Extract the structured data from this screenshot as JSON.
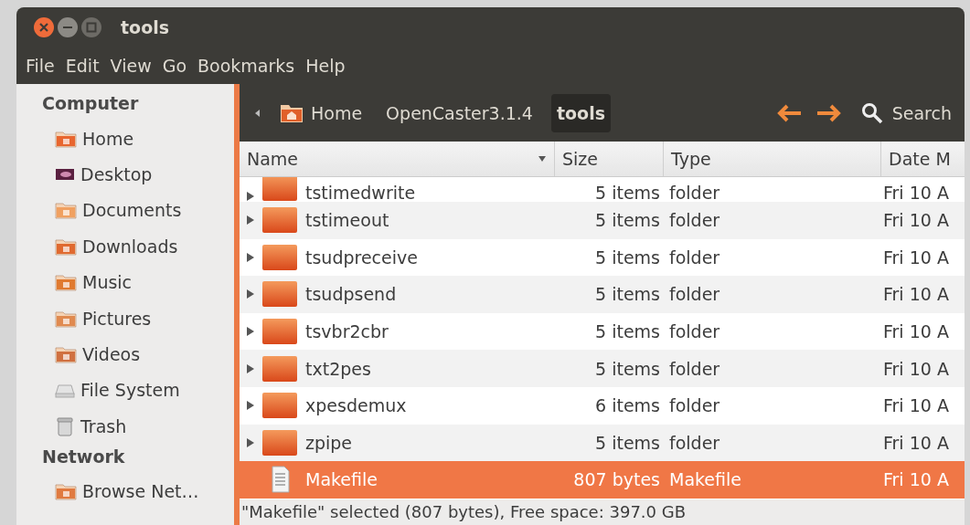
{
  "window": {
    "title": "tools"
  },
  "menu": [
    "File",
    "Edit",
    "View",
    "Go",
    "Bookmarks",
    "Help"
  ],
  "sidebar": {
    "sections": [
      {
        "heading": "Computer",
        "items": [
          {
            "kind": "home",
            "label": "Home"
          },
          {
            "kind": "desktop",
            "label": "Desktop"
          },
          {
            "kind": "documents",
            "label": "Documents"
          },
          {
            "kind": "downloads",
            "label": "Downloads"
          },
          {
            "kind": "music",
            "label": "Music"
          },
          {
            "kind": "pictures",
            "label": "Pictures"
          },
          {
            "kind": "videos",
            "label": "Videos"
          },
          {
            "kind": "drive",
            "label": "File System"
          },
          {
            "kind": "trash",
            "label": "Trash"
          }
        ]
      },
      {
        "heading": "Network",
        "items": [
          {
            "kind": "network",
            "label": "Browse Net…"
          }
        ]
      }
    ]
  },
  "toolbar": {
    "breadcrumbs": [
      {
        "label": "Home",
        "home": true,
        "selected": false
      },
      {
        "label": "OpenCaster3.1.4",
        "home": false,
        "selected": false
      },
      {
        "label": "tools",
        "home": false,
        "selected": true
      }
    ],
    "search": "Search"
  },
  "table": {
    "columns": [
      "Name",
      "Size",
      "Type",
      "Date M"
    ],
    "rows": [
      {
        "kind": "folder",
        "name": "tstimedwrite",
        "size": "5 items",
        "type": "folder",
        "date": "Fri 10 A",
        "selected": false,
        "partial": true
      },
      {
        "kind": "folder",
        "name": "tstimeout",
        "size": "5 items",
        "type": "folder",
        "date": "Fri 10 A",
        "selected": false,
        "partial": false
      },
      {
        "kind": "folder",
        "name": "tsudpreceive",
        "size": "5 items",
        "type": "folder",
        "date": "Fri 10 A",
        "selected": false,
        "partial": false
      },
      {
        "kind": "folder",
        "name": "tsudpsend",
        "size": "5 items",
        "type": "folder",
        "date": "Fri 10 A",
        "selected": false,
        "partial": false
      },
      {
        "kind": "folder",
        "name": "tsvbr2cbr",
        "size": "5 items",
        "type": "folder",
        "date": "Fri 10 A",
        "selected": false,
        "partial": false
      },
      {
        "kind": "folder",
        "name": "txt2pes",
        "size": "5 items",
        "type": "folder",
        "date": "Fri 10 A",
        "selected": false,
        "partial": false
      },
      {
        "kind": "folder",
        "name": "xpesdemux",
        "size": "6 items",
        "type": "folder",
        "date": "Fri 10 A",
        "selected": false,
        "partial": false
      },
      {
        "kind": "folder",
        "name": "zpipe",
        "size": "5 items",
        "type": "folder",
        "date": "Fri 10 A",
        "selected": false,
        "partial": false
      },
      {
        "kind": "file",
        "name": "Makefile",
        "size": "807 bytes",
        "type": "Makefile",
        "date": "Fri 10 A",
        "selected": true,
        "partial": false
      }
    ]
  },
  "status_bar": "\"Makefile\" selected (807 bytes), Free space: 397.0 GB"
}
